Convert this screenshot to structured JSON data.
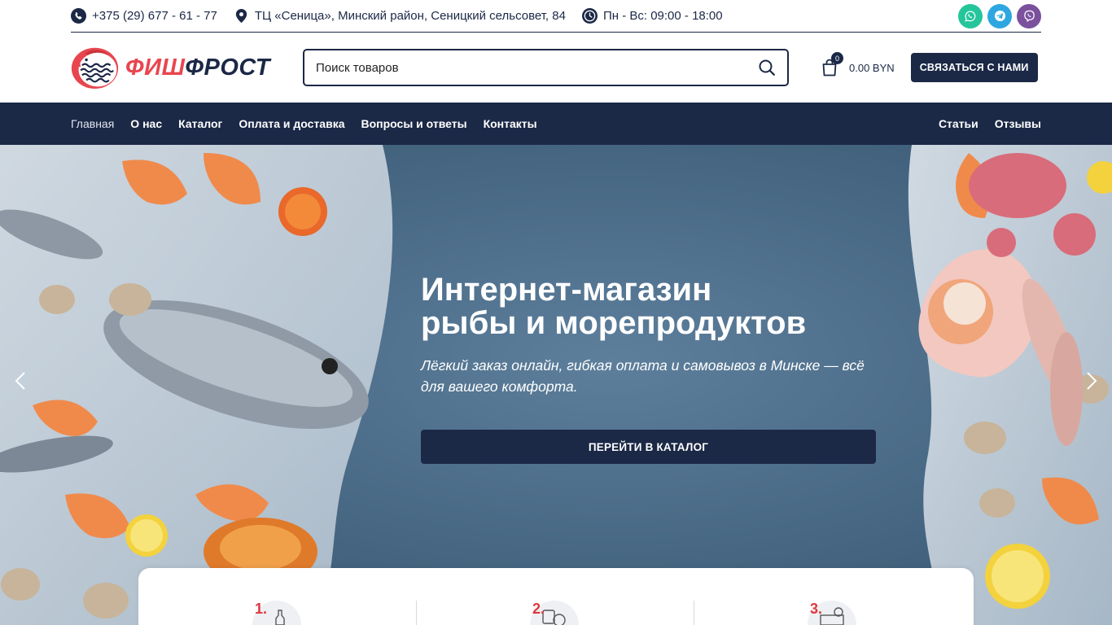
{
  "topbar": {
    "phone": "+375 (29) 677 - 61 - 77",
    "address": "ТЦ «Сеница», Минский район, Сеницкий сельсовет, 84",
    "hours": "Пн - Вс: 09:00 - 18:00",
    "social": [
      {
        "name": "whatsapp",
        "color": "#25c59b"
      },
      {
        "name": "telegram",
        "color": "#2ea7e0"
      },
      {
        "name": "viber",
        "color": "#7b519d"
      }
    ]
  },
  "header": {
    "logo_part1": "ФИШ",
    "logo_part2": "ФРОСТ",
    "search_placeholder": "Поиск товаров",
    "cart_count": "0",
    "cart_total": "0.00 BYN",
    "contact_label": "Связаться с нами"
  },
  "nav": {
    "left": [
      "Главная",
      "О нас",
      "Каталог",
      "Оплата и доставка",
      "Вопросы и ответы",
      "Контакты"
    ],
    "right": [
      "Статьи",
      "Отзывы"
    ]
  },
  "hero": {
    "title_line1": "Интернет-магазин",
    "title_line2": "рыбы и морепродуктов",
    "subtitle": "Лёгкий заказ онлайн, гибкая оплата и самовывоз в Минске — всё для вашего комфорта.",
    "button_label": "ПЕРЕЙТИ В КАТАЛОГ"
  },
  "steps": [
    {
      "num": "1.",
      "icon": "bottle-icon"
    },
    {
      "num": "2.",
      "icon": "payment-icon"
    },
    {
      "num": "3.",
      "icon": "delivery-icon"
    }
  ],
  "colors": {
    "navy": "#1b2846",
    "brand_red": "#e8464f",
    "step_red": "#e0373f"
  }
}
